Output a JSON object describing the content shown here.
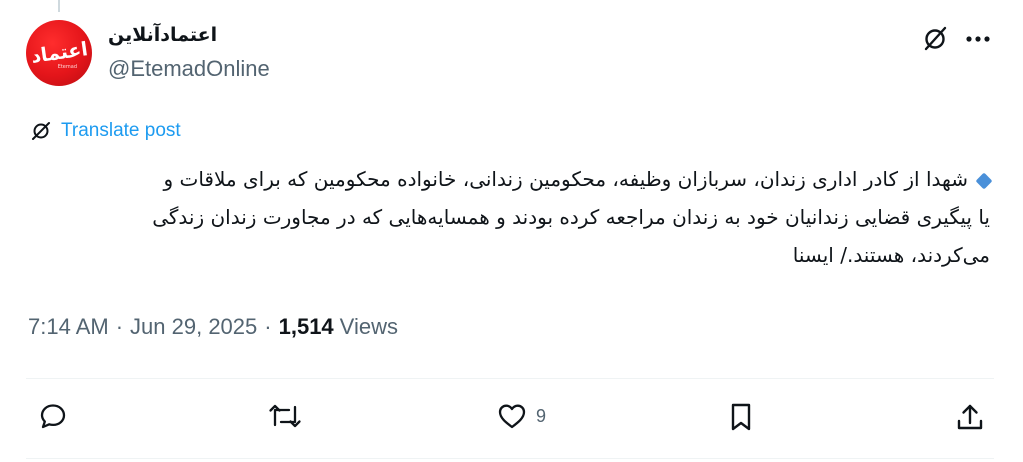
{
  "author": {
    "display_name": "اعتمادآنلاین",
    "handle": "@EtemadOnline",
    "avatar_text": "اعتماد",
    "avatar_subtext": "Etemad"
  },
  "translate": {
    "label": "Translate post"
  },
  "post": {
    "lines": [
      "شهدا از کادر اداری زندان، سربازان وظیفه، محکومین زندانی، خانواده محکومین که برای ملاقات و",
      "یا پیگیری قضایی زندانیان خود به زندان مراجعه کرده بودند و  همسایه‌هایی که در مجاورت زندان زندگی",
      "می‌کردند، هستند./ ایسنا"
    ]
  },
  "meta": {
    "time": "7:14 AM",
    "date": "Jun 29, 2025",
    "views_count": "1,514",
    "views_label": "Views",
    "separator": "·"
  },
  "actions": {
    "like_count": "9"
  },
  "colors": {
    "accent": "#1d9bf0",
    "secondary_text": "#536471",
    "primary_text": "#0f1419"
  }
}
